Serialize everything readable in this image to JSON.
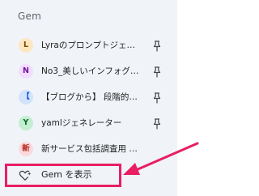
{
  "sidebar": {
    "section_title": "Gem",
    "gems": [
      {
        "initial": "L",
        "label": "Lyraのプロンプトジェ…",
        "avatar_bg": "#fde7c2",
        "avatar_fg": "#7a4a00"
      },
      {
        "initial": "N",
        "label": "No3_美しいインフォグ…",
        "avatar_bg": "#f3dcff",
        "avatar_fg": "#6a1b9a"
      },
      {
        "initial": "【",
        "label": "【ブログから】 段階的…",
        "avatar_bg": "#d3e3fd",
        "avatar_fg": "#0b57d0"
      },
      {
        "initial": "Y",
        "label": "yamlジェネレーター",
        "avatar_bg": "#c4eed0",
        "avatar_fg": "#0d652d"
      },
      {
        "initial": "新",
        "label": "新サービス包括調査用 …",
        "avatar_bg": "#fbd9dd",
        "avatar_fg": "#b3261e"
      }
    ],
    "show_gems_label": "Gem を表示"
  },
  "annotation": {
    "highlight_color": "#e91e63"
  }
}
